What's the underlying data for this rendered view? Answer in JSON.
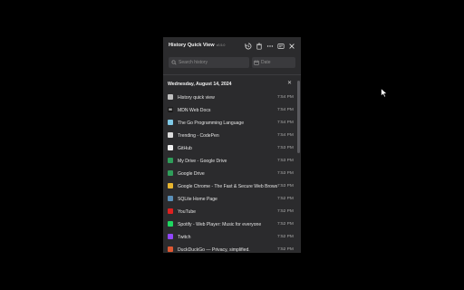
{
  "header": {
    "title": "History Quick View",
    "version": "v0.5.0",
    "icons": [
      "history-icon",
      "trash-icon",
      "more-icon",
      "card-icon",
      "close-icon"
    ]
  },
  "search": {
    "placeholder": "Search history"
  },
  "date": {
    "placeholder": "Date"
  },
  "section": {
    "label": "Wednesday, August 14, 2024"
  },
  "rows": [
    {
      "title": "History quick view",
      "time": "7:54 PM",
      "icon": "history-quick-view-favicon",
      "color": "#bfbfbf",
      "glyph": ""
    },
    {
      "title": "MDN Web Docs",
      "time": "7:54 PM",
      "icon": "mdn-favicon",
      "color": "#1b1b1b",
      "glyph": "M"
    },
    {
      "title": "The Go Programming Language",
      "time": "7:54 PM",
      "icon": "go-favicon",
      "color": "#7fc9e6",
      "glyph": ""
    },
    {
      "title": "Trending - CodePen",
      "time": "7:54 PM",
      "icon": "codepen-favicon",
      "color": "#dcdcdc",
      "glyph": ""
    },
    {
      "title": "GitHub",
      "time": "7:53 PM",
      "icon": "github-favicon",
      "color": "#f0f0f0",
      "glyph": ""
    },
    {
      "title": "My Drive - Google Drive",
      "time": "7:53 PM",
      "icon": "google-drive-favicon",
      "color": "#2f9e5a",
      "glyph": ""
    },
    {
      "title": "Google Drive",
      "time": "7:53 PM",
      "icon": "google-drive-favicon",
      "color": "#2f9e5a",
      "glyph": ""
    },
    {
      "title": "Google Chrome - The Fast & Secure Web Browser Built to be Yours",
      "time": "7:53 PM",
      "icon": "chrome-favicon",
      "color": "#e8b52f",
      "glyph": ""
    },
    {
      "title": "SQLite Home Page",
      "time": "7:52 PM",
      "icon": "sqlite-favicon",
      "color": "#5a8fb8",
      "glyph": ""
    },
    {
      "title": "YouTube",
      "time": "7:52 PM",
      "icon": "youtube-favicon",
      "color": "#e02020",
      "glyph": ""
    },
    {
      "title": "Spotify - Web Player: Music for everyone",
      "time": "7:52 PM",
      "icon": "spotify-favicon",
      "color": "#1ed760",
      "glyph": ""
    },
    {
      "title": "Twitch",
      "time": "7:52 PM",
      "icon": "twitch-favicon",
      "color": "#9146ff",
      "glyph": ""
    },
    {
      "title": "DuckDuckGo — Privacy, simplified.",
      "time": "7:52 PM",
      "icon": "duckduckgo-favicon",
      "color": "#de5833",
      "glyph": ""
    }
  ]
}
